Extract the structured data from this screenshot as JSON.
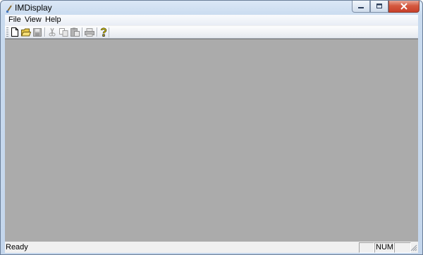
{
  "window": {
    "title": "IMDisplay"
  },
  "menu": {
    "items": [
      "File",
      "View",
      "Help"
    ]
  },
  "toolbar": {
    "buttons": [
      {
        "icon": "new-document-icon",
        "enabled": true
      },
      {
        "icon": "open-folder-icon",
        "enabled": true
      },
      {
        "icon": "save-icon",
        "enabled": false
      },
      {
        "icon": "cut-icon",
        "enabled": false
      },
      {
        "icon": "copy-icon",
        "enabled": false
      },
      {
        "icon": "paste-icon",
        "enabled": false
      },
      {
        "icon": "print-icon",
        "enabled": false
      },
      {
        "icon": "help-icon",
        "enabled": true
      }
    ]
  },
  "workspace": {
    "background": "#ababab"
  },
  "status": {
    "text": "Ready",
    "pane1": "",
    "pane2": "NUM",
    "pane3": ""
  }
}
